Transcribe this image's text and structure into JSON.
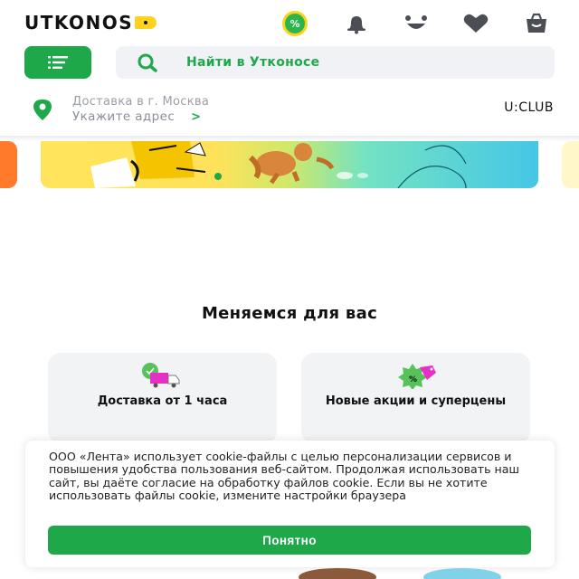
{
  "header": {
    "logo_text": "UTKONOS",
    "icons": [
      "percent-badge-icon",
      "bell-icon",
      "smile-icon",
      "heart-icon",
      "bag-icon"
    ],
    "promo_badge_text": "%"
  },
  "search": {
    "placeholder": "Найти в Утконосе"
  },
  "delivery": {
    "label": "Доставка в г. Москва",
    "address_prompt": "Укажите адрес",
    "chevron": ">"
  },
  "uclub": "U:CLUB",
  "section": {
    "title": "Меняемся для вас",
    "cards": [
      {
        "text": "Доставка от 1 часа",
        "icon": "delivery-truck-icon"
      },
      {
        "text": "Новые акции и суперцены",
        "icon": "price-tag-icon"
      }
    ]
  },
  "cookie": {
    "text": "ООО «Лента» использует cookie-файлы с целью персонализации сервисов и повышения удобства пользования веб-сайтом. Продолжая использовать наш сайт, вы даёте согласие на обработку файлов cookie. Если вы не хотите использовать файлы cookie, измените настройки браузера",
    "button": "Понятно"
  },
  "colors": {
    "brand_green": "#1ea84a",
    "accent_yellow": "#ffd21f",
    "search_bg": "#f0f2f5",
    "card_bg": "#f2f3f5"
  }
}
